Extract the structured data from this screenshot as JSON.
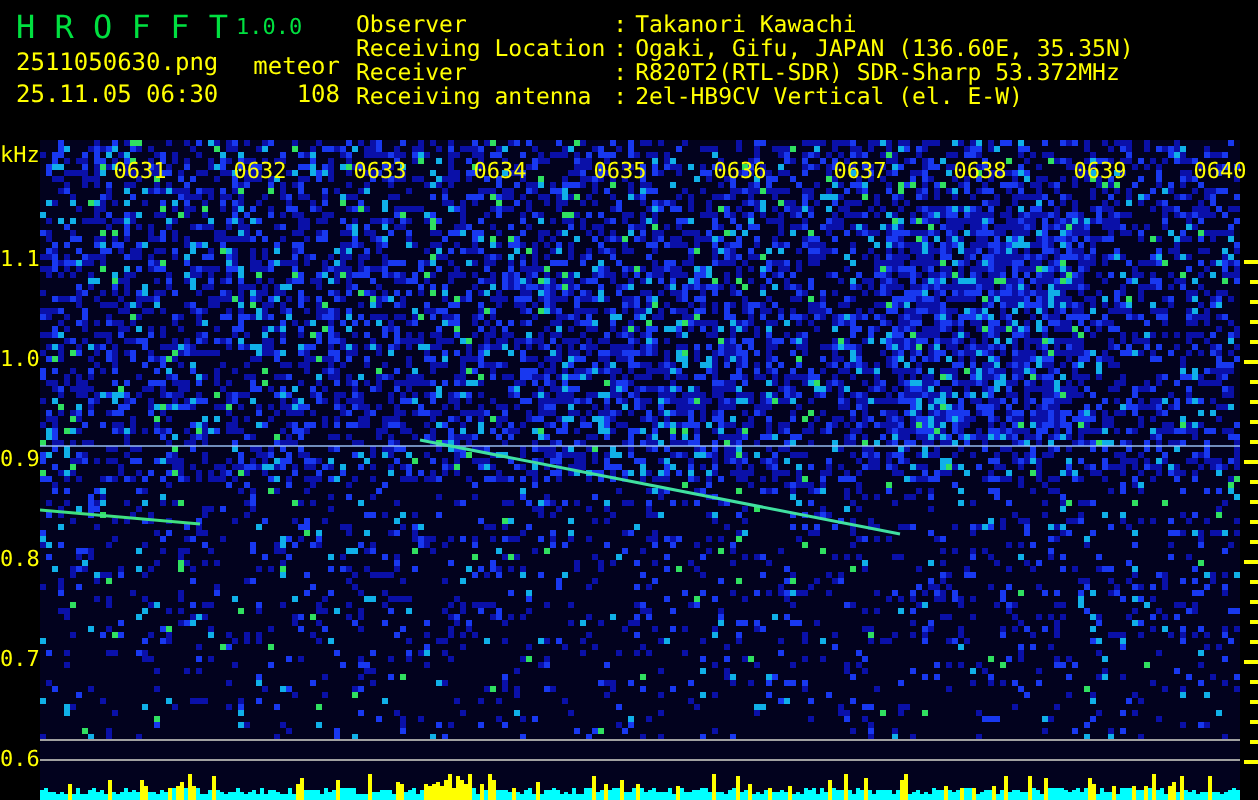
{
  "app": {
    "name": "H R O F F T",
    "version": "1.0.0"
  },
  "capture": {
    "filename": "2511050630.png",
    "timestamp": "25.11.05 06:30",
    "count_label": "meteor",
    "count": "108"
  },
  "info": [
    {
      "label": "Observer",
      "separator": ":",
      "value": "Takanori Kawachi"
    },
    {
      "label": "Receiving Location",
      "separator": ":",
      "value": "Ogaki, Gifu, JAPAN (136.60E, 35.35N)"
    },
    {
      "label": "Receiver",
      "separator": ":",
      "value": "R820T2(RTL-SDR) SDR-Sharp 53.372MHz"
    },
    {
      "label": "Receiving antenna",
      "separator": ":",
      "value": "2el-HB9CV Vertical (el. E-W)"
    }
  ],
  "y_axis": {
    "unit": "kHz",
    "labels": [
      "1.1",
      "1.0",
      "0.9",
      "0.8",
      "0.7",
      "0.6"
    ]
  },
  "time_labels": [
    "0631",
    "0632",
    "0633",
    "0634",
    "0635",
    "0636",
    "0637",
    "0638",
    "0639",
    "0640"
  ]
}
